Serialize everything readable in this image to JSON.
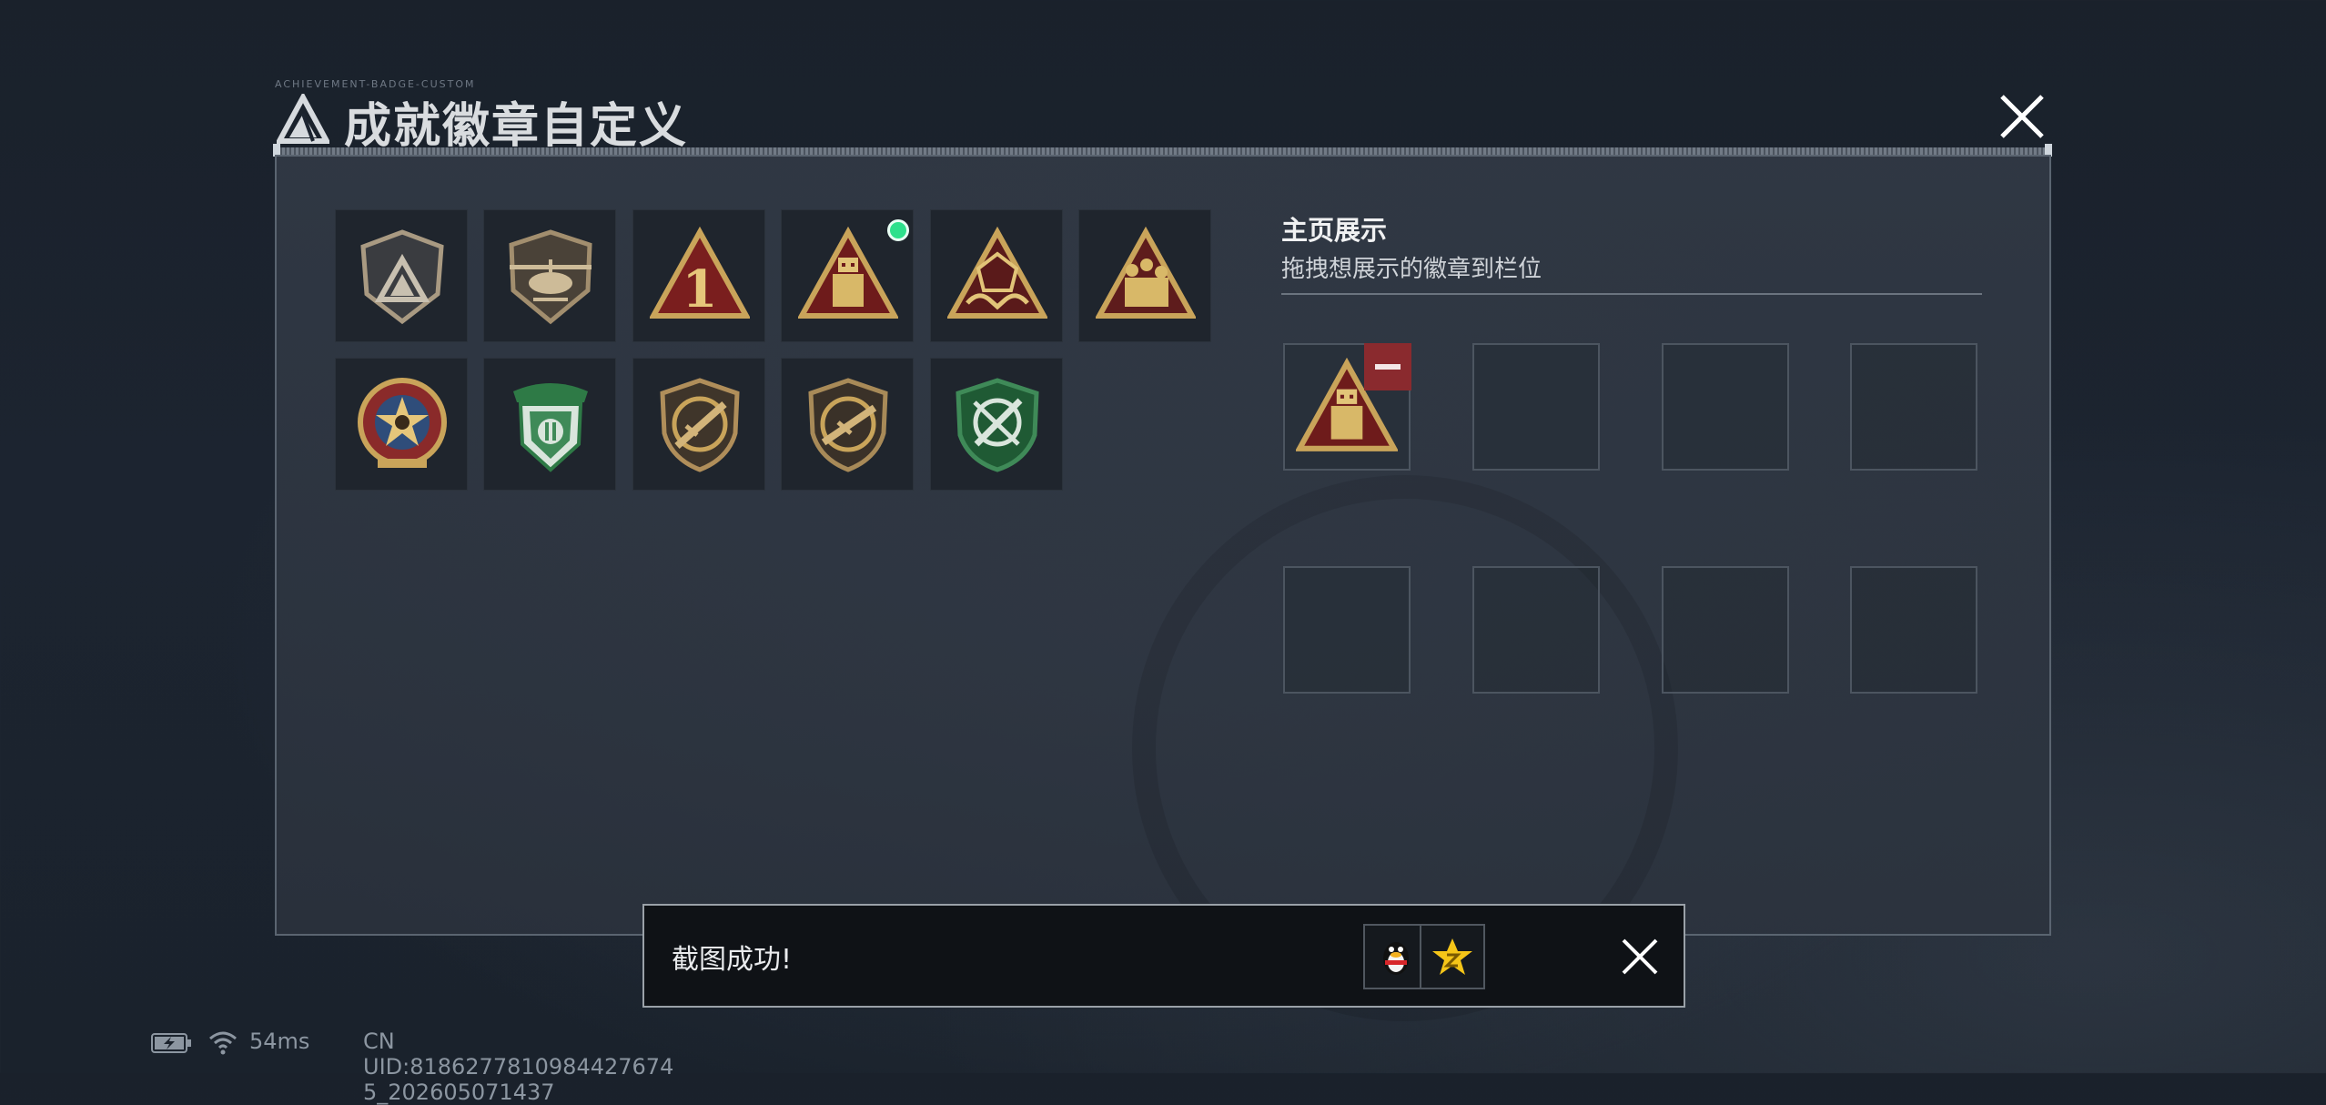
{
  "window": {
    "title": "成就徽章自定义",
    "tiny_caption": "ACHIEVEMENT-BADGE-CUSTOM"
  },
  "badges": {
    "row1": [
      "nova-shield-badge",
      "helicopter-shield-badge",
      "number-one-triangle-badge",
      "robot-triangle-badge",
      "d20-hands-triangle-badge",
      "squad-triangle-badge"
    ],
    "row2": [
      "red-star-medal-badge",
      "green-ribbon-shield-badge",
      "rifle-bronze-shield-badge",
      "rifle-bronze-shield-badge-2",
      "crossed-rifles-green-shield-badge"
    ],
    "new_indicator_on": "robot-triangle-badge"
  },
  "showcase": {
    "title": "主页展示",
    "subtitle": "拖拽想展示的徽章到栏位",
    "slots": [
      "robot-triangle-badge",
      "",
      "",
      "",
      "",
      "",
      "",
      ""
    ]
  },
  "toast": {
    "message": "截图成功!",
    "share_qq_icon": "qq-penguin-icon",
    "share_qzone_icon": "qzone-star-icon"
  },
  "status": {
    "ping": "54ms",
    "uid": "CN UID:8186277810984427674​5_202605071437"
  },
  "colors": {
    "accent_gold": "#c9a45a",
    "new_dot": "#2ee08c",
    "remove_red": "#8a2a2e"
  }
}
